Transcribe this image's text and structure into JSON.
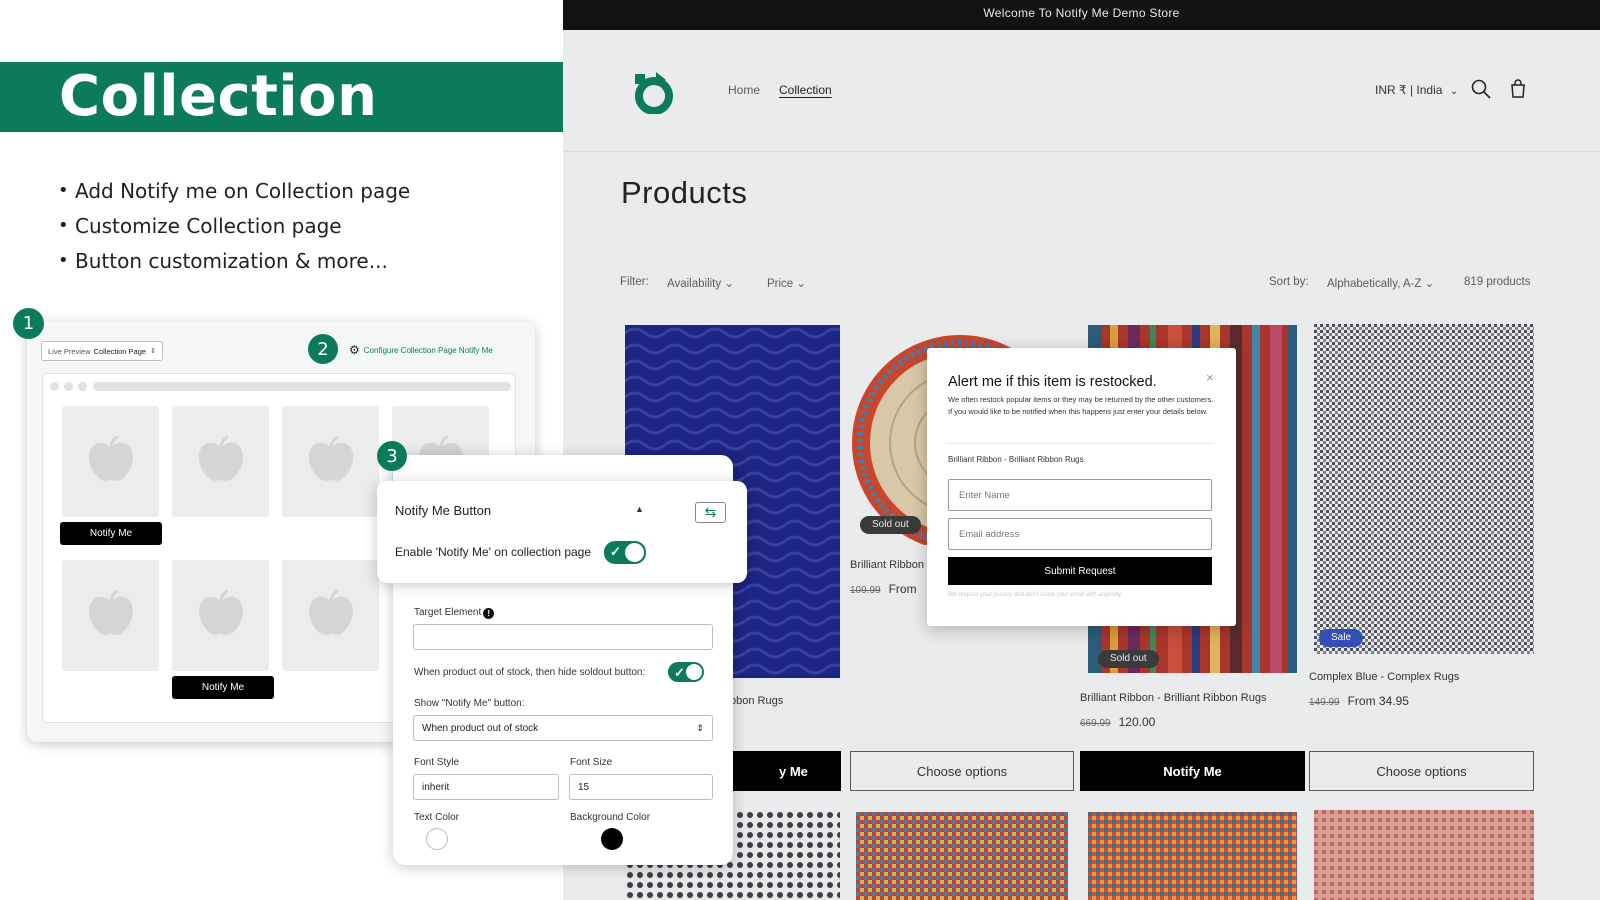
{
  "promo": {
    "title": "Collection",
    "bullets": [
      "Add Notify me on Collection page",
      "Customize Collection page",
      "Button customization & more..."
    ],
    "badges": [
      "1",
      "2",
      "3"
    ],
    "brand_color": "#0b7b5c"
  },
  "preview": {
    "select_prefix": "Live Preview",
    "select_value": "Collection Page",
    "config_link": "Configure Collection Page Notify Me",
    "notify_label": "Notify Me"
  },
  "settings": {
    "target_element_label": "Target Element",
    "hide_soldout_label": "When product out of stock, then hide soldout button:",
    "show_button_label": "Show \"Notify Me\" button:",
    "show_button_value": "When product out of stock",
    "font_style_label": "Font Style",
    "font_style_value": "inherit",
    "font_size_label": "Font Size",
    "font_size_value": "15",
    "text_color_label": "Text Color",
    "bg_color_label": "Background Color",
    "text_color": "#ffffff",
    "bg_color": "#000000"
  },
  "notify_button_card": {
    "title": "Notify Me Button",
    "enable_label": "Enable 'Notify Me' on collection page"
  },
  "store": {
    "announcement": "Welcome To Notify Me Demo Store",
    "nav": [
      "Home",
      "Collection"
    ],
    "currency": "INR ₹ | India",
    "page_title": "Products",
    "filter_label": "Filter:",
    "filters": [
      "Availability",
      "Price"
    ],
    "sort_label": "Sort by:",
    "sort_value": "Alphabetically, A-Z",
    "product_count": "819 products",
    "products": [
      {
        "name": "bbon Rugs"
      },
      {
        "name": "Brilliant Ribbon",
        "compare_price": "109.99",
        "price": "From",
        "tag": "Sold out"
      },
      {
        "name": "Brilliant Ribbon - Brilliant Ribbon Rugs",
        "compare_price": "669.99",
        "price": "120.00",
        "tag": "Sold out"
      },
      {
        "name": "Complex Blue - Complex Rugs",
        "compare_price": "149.99",
        "price": "From 34.95",
        "tag": "Sale"
      }
    ],
    "buttons": [
      "y Me",
      "Choose options",
      "Notify Me",
      "Choose options"
    ]
  },
  "popup": {
    "title": "Alert me if this item is restocked.",
    "close": "×",
    "description": "We often restock popular items or they may be returned by the other customers. If you would like to be notified when this happens just enter your details below.",
    "product": "Brilliant Ribbon - Brilliant Ribbon Rugs",
    "name_placeholder": "Enter Name",
    "email_placeholder": "Email address",
    "submit": "Submit Request",
    "privacy": "We respect your privacy and don't share your email with anybody."
  },
  "icons": [
    "gear-icon",
    "apple-placeholder-icon",
    "swap-icon",
    "info-icon",
    "search-icon",
    "cart-icon",
    "chevron-down-icon",
    "check-icon",
    "close-icon"
  ]
}
